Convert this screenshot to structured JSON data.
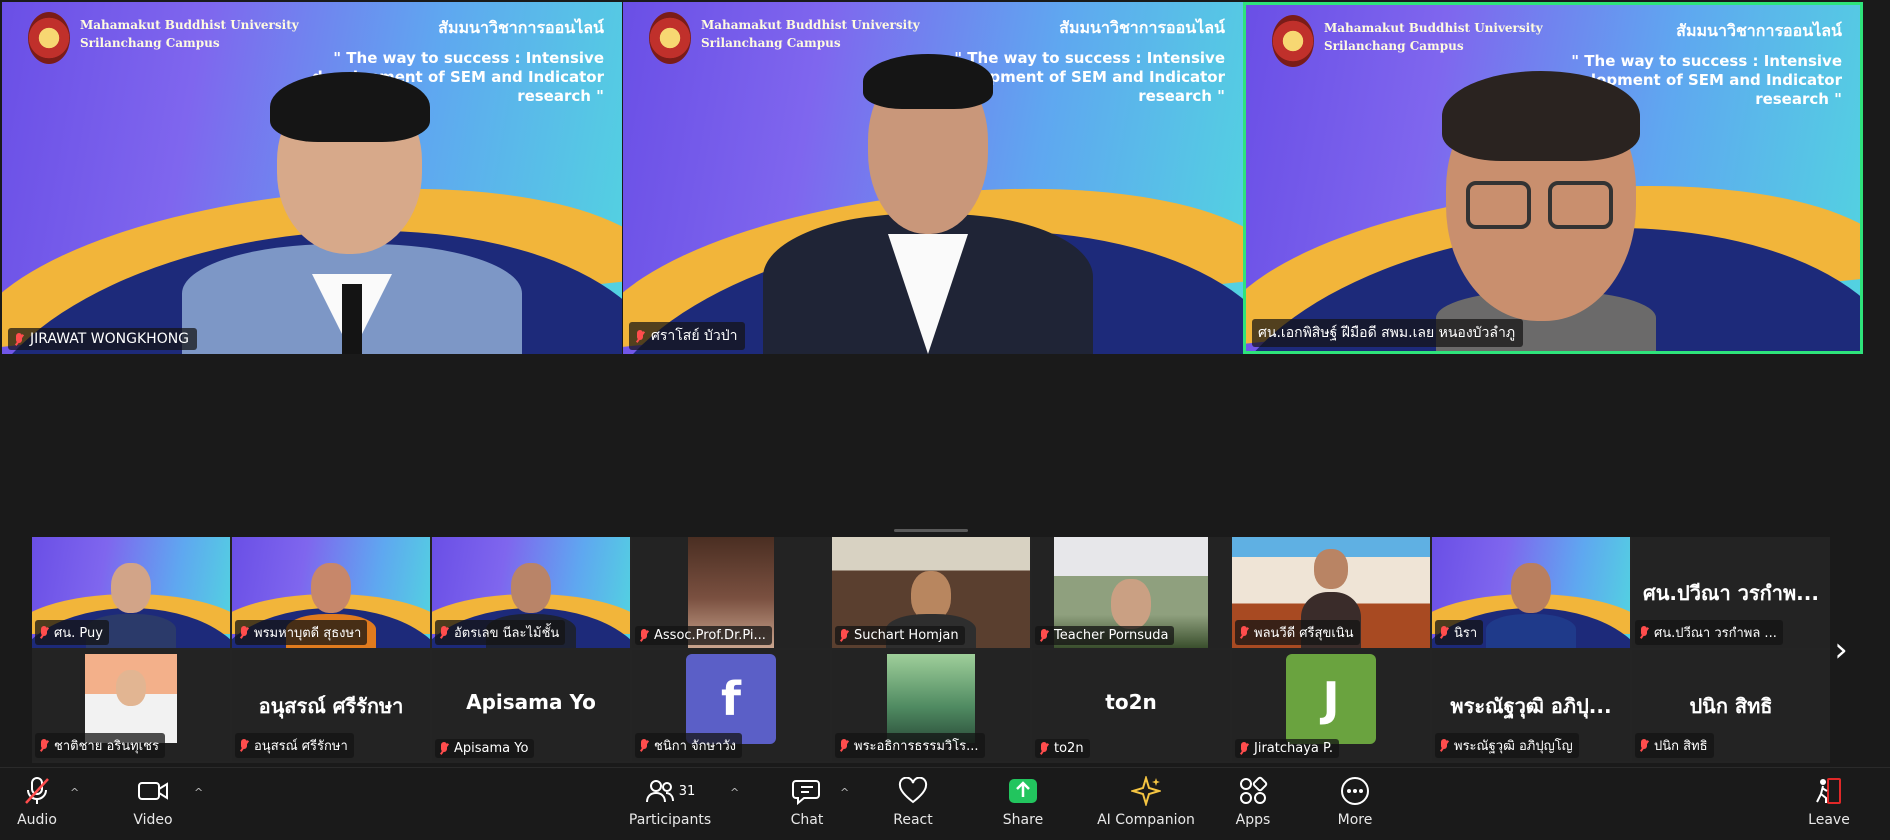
{
  "speakers": [
    {
      "name": "JIRAWAT WONGKHONG",
      "university": "Mahamakut Buddhist University",
      "campus": "Srilanchang Campus",
      "seminar_th": "สัมมนาวิชาการออนไลน์",
      "seminar_en": "\" The way to success : Intensive development of SEM and Indicator research \"",
      "active": false
    },
    {
      "name": "ศราโสย์ บัวป่า",
      "university": "Mahamakut Buddhist University",
      "campus": "Srilanchang Campus",
      "seminar_th": "สัมมนาวิชาการออนไลน์",
      "seminar_en": "\" The way to success : Intensive development of SEM and Indicator research \"",
      "active": false
    },
    {
      "name": "ศน.เอกพิสิษฐ์ ฝีมือดี สพม.เลย หนองบัวลำภู",
      "university": "Mahamakut Buddhist University",
      "campus": "Srilanchang Campus",
      "seminar_th": "สัมมนาวิชาการออนไลน์",
      "seminar_en": "\" The way to success : Intensive development of SEM and Indicator research \"",
      "active": true
    }
  ],
  "gallery_row1": [
    {
      "name": "ศน. Puy",
      "kind": "video-bg"
    },
    {
      "name": "พรมหาบุตดี สุธงษา",
      "kind": "video-bg"
    },
    {
      "name": "อัตรเลข นีละไม้ชั้น",
      "kind": "video-bg"
    },
    {
      "name": "Assoc.Prof.Dr.Pi...",
      "kind": "video-dark"
    },
    {
      "name": "Suchart Homjan",
      "kind": "video-room"
    },
    {
      "name": "Teacher Pornsuda",
      "kind": "video-outdoor"
    },
    {
      "name": "พลนวีดี ศรีสุขเนิน",
      "kind": "video-office"
    },
    {
      "name": "นิรา",
      "kind": "video-bg"
    },
    {
      "name": "ศน.ปวีณา วรกำพล ...",
      "big_name": "ศน.ปวีณา วรกำพ...",
      "kind": "name-only"
    }
  ],
  "gallery_row2": [
    {
      "name": "ชาติชาย อรินทุเชร",
      "kind": "video-photo"
    },
    {
      "name": "อนุสรณ์ ศรีรักษา",
      "big_name": "อนุสรณ์ ศรีรักษา",
      "kind": "name-only"
    },
    {
      "name": "Apisama Yo",
      "big_name": "Apisama Yo",
      "kind": "name-only"
    },
    {
      "name": "ชนิกา จักษาวัง",
      "avatar": "f",
      "avatar_color": "#5b5fc7",
      "kind": "avatar"
    },
    {
      "name": "พระอธิการธรรมวิโร...",
      "kind": "video-forest"
    },
    {
      "name": "to2n",
      "big_name": "to2n",
      "kind": "name-only"
    },
    {
      "name": "Jiratchaya P.",
      "avatar": "J",
      "avatar_color": "#6aa33f",
      "kind": "avatar"
    },
    {
      "name": "พระณัฐวุฒิ อภิปุญโญ",
      "big_name": "พระณัฐวุฒิ อภิปุ...",
      "kind": "name-only"
    },
    {
      "name": "ปนิก สิทธิ",
      "big_name": "ปนิก สิทธิ",
      "kind": "name-only"
    }
  ],
  "toolbar": {
    "audio": "Audio",
    "video": "Video",
    "participants": "Participants",
    "participants_count": "31",
    "chat": "Chat",
    "react": "React",
    "share": "Share",
    "ai_companion": "AI Companion",
    "apps": "Apps",
    "more": "More",
    "leave": "Leave"
  },
  "colors": {
    "accent_green": "#2ee37b",
    "share_green": "#22c55e",
    "mic_muted": "#ff4d4d",
    "leave_red": "#e02828"
  }
}
